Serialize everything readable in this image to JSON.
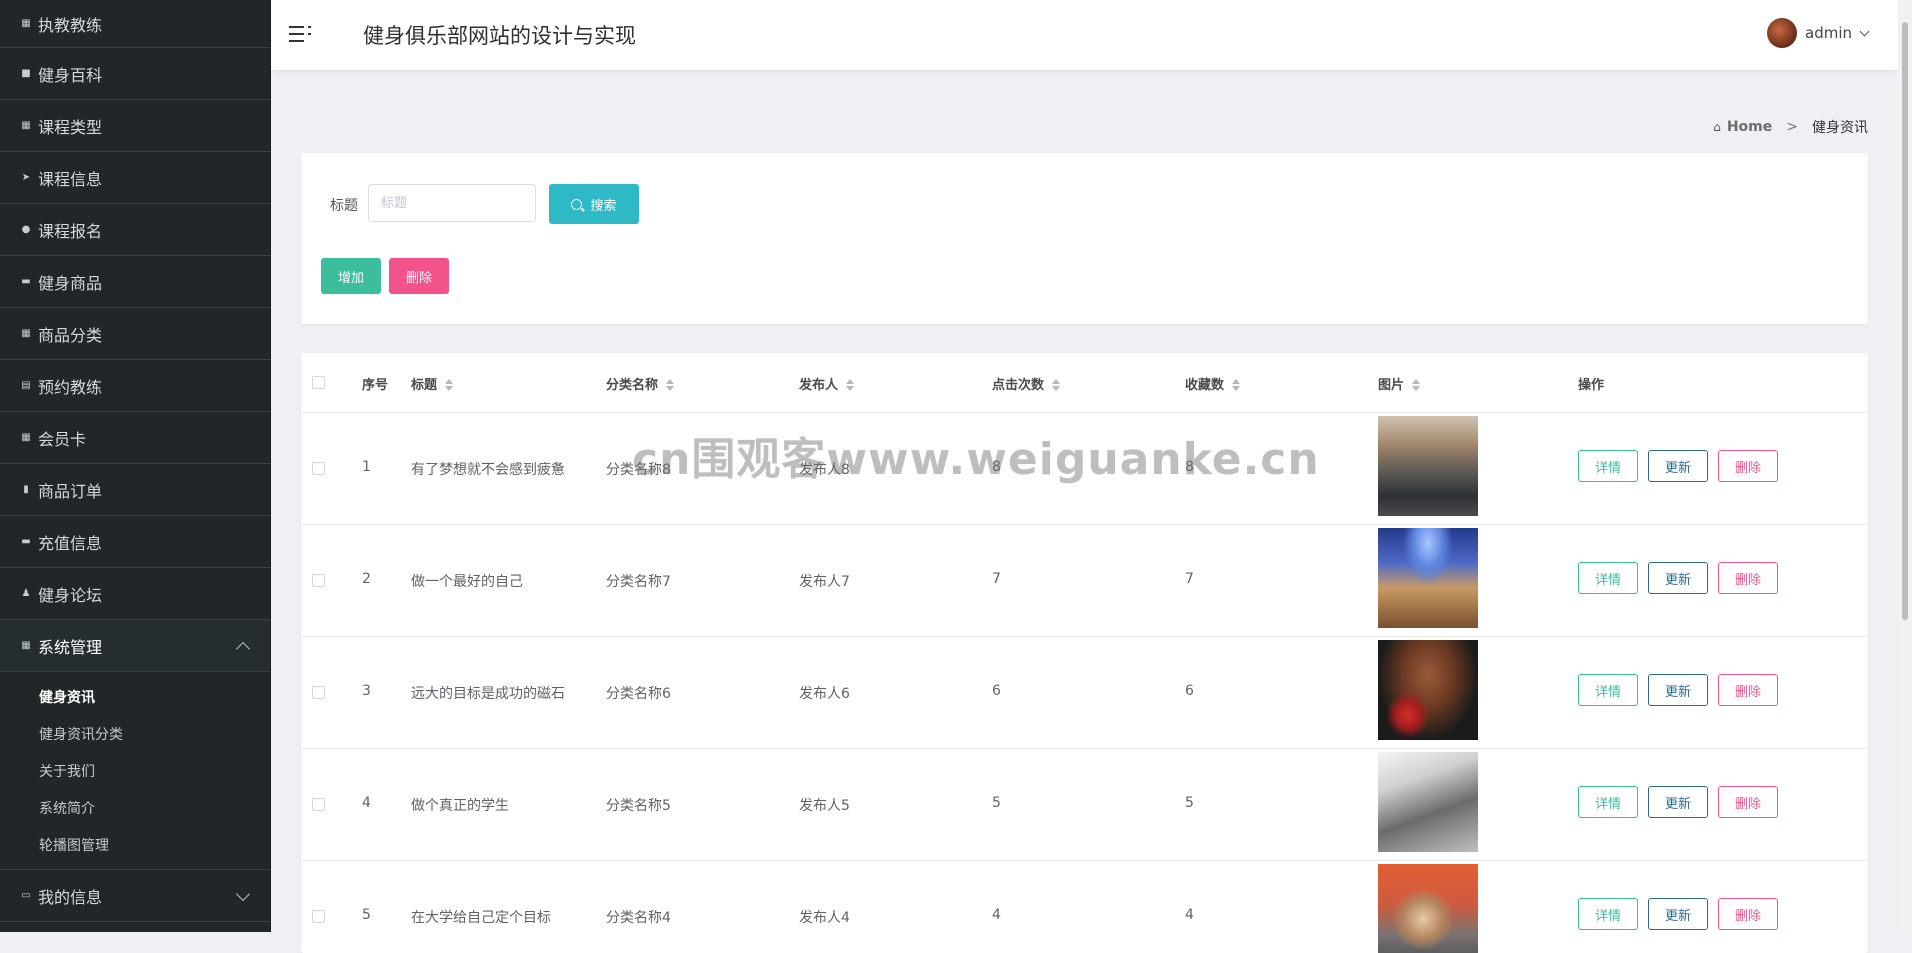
{
  "sidebar": {
    "items": [
      {
        "label": "执教教练",
        "icon": "list-icon",
        "glyph": "▦"
      },
      {
        "label": "健身百科",
        "icon": "briefcase-icon",
        "glyph": "■"
      },
      {
        "label": "课程类型",
        "icon": "grid-icon",
        "glyph": "▦"
      },
      {
        "label": "课程信息",
        "icon": "send-icon",
        "glyph": "➤"
      },
      {
        "label": "课程报名",
        "icon": "map-pin-icon",
        "glyph": "●"
      },
      {
        "label": "健身商品",
        "icon": "ticket-icon",
        "glyph": "▬"
      },
      {
        "label": "商品分类",
        "icon": "grid-icon",
        "glyph": "▦"
      },
      {
        "label": "预约教练",
        "icon": "document-icon",
        "glyph": "▤"
      },
      {
        "label": "会员卡",
        "icon": "grid-icon",
        "glyph": "▦"
      },
      {
        "label": "商品订单",
        "icon": "bar-chart-icon",
        "glyph": "▮"
      },
      {
        "label": "充值信息",
        "icon": "comment-icon",
        "glyph": "▬"
      },
      {
        "label": "健身论坛",
        "icon": "user-icon",
        "glyph": "♟"
      }
    ],
    "system": {
      "label": "系统管理",
      "icon": "grid-icon",
      "glyph": "▦",
      "children": [
        {
          "label": "健身资讯",
          "active": true
        },
        {
          "label": "健身资讯分类"
        },
        {
          "label": "关于我们"
        },
        {
          "label": "系统简介"
        },
        {
          "label": "轮播图管理"
        }
      ]
    },
    "my_info": {
      "label": "我的信息",
      "icon": "calendar-icon",
      "glyph": "▭"
    }
  },
  "header": {
    "title": "健身俱乐部网站的设计与实现",
    "username": "admin"
  },
  "breadcrumb": {
    "home": "Home",
    "separator": ">",
    "current": "健身资讯"
  },
  "search": {
    "label": "标题",
    "placeholder": "标题",
    "button": "搜索"
  },
  "actions": {
    "add": "增加",
    "delete": "删除"
  },
  "table": {
    "columns": [
      "序号",
      "标题",
      "分类名称",
      "发布人",
      "点击次数",
      "收藏数",
      "图片",
      "操作"
    ],
    "rows": [
      {
        "index": "1",
        "title": "有了梦想就不会感到疲惫",
        "category": "分类名称8",
        "publisher": "发布人8",
        "clicks": "8",
        "favorites": "8"
      },
      {
        "index": "2",
        "title": "做一个最好的自己",
        "category": "分类名称7",
        "publisher": "发布人7",
        "clicks": "7",
        "favorites": "7"
      },
      {
        "index": "3",
        "title": "远大的目标是成功的磁石",
        "category": "分类名称6",
        "publisher": "发布人6",
        "clicks": "6",
        "favorites": "6"
      },
      {
        "index": "4",
        "title": "做个真正的学生",
        "category": "分类名称5",
        "publisher": "发布人5",
        "clicks": "5",
        "favorites": "5"
      },
      {
        "index": "5",
        "title": "在大学给自己定个目标",
        "category": "分类名称4",
        "publisher": "发布人4",
        "clicks": "4",
        "favorites": "4"
      }
    ],
    "row_actions": {
      "detail": "详情",
      "update": "更新",
      "delete": "删除"
    }
  },
  "watermark": "cn围观客www.weiguanke.cn",
  "colors": {
    "sidebar_bg": "#212728",
    "search_button": "#2fb8c5",
    "add_button": "#3cbd9c",
    "delete_button": "#f2538a",
    "update_button": "#2a6b8a"
  }
}
